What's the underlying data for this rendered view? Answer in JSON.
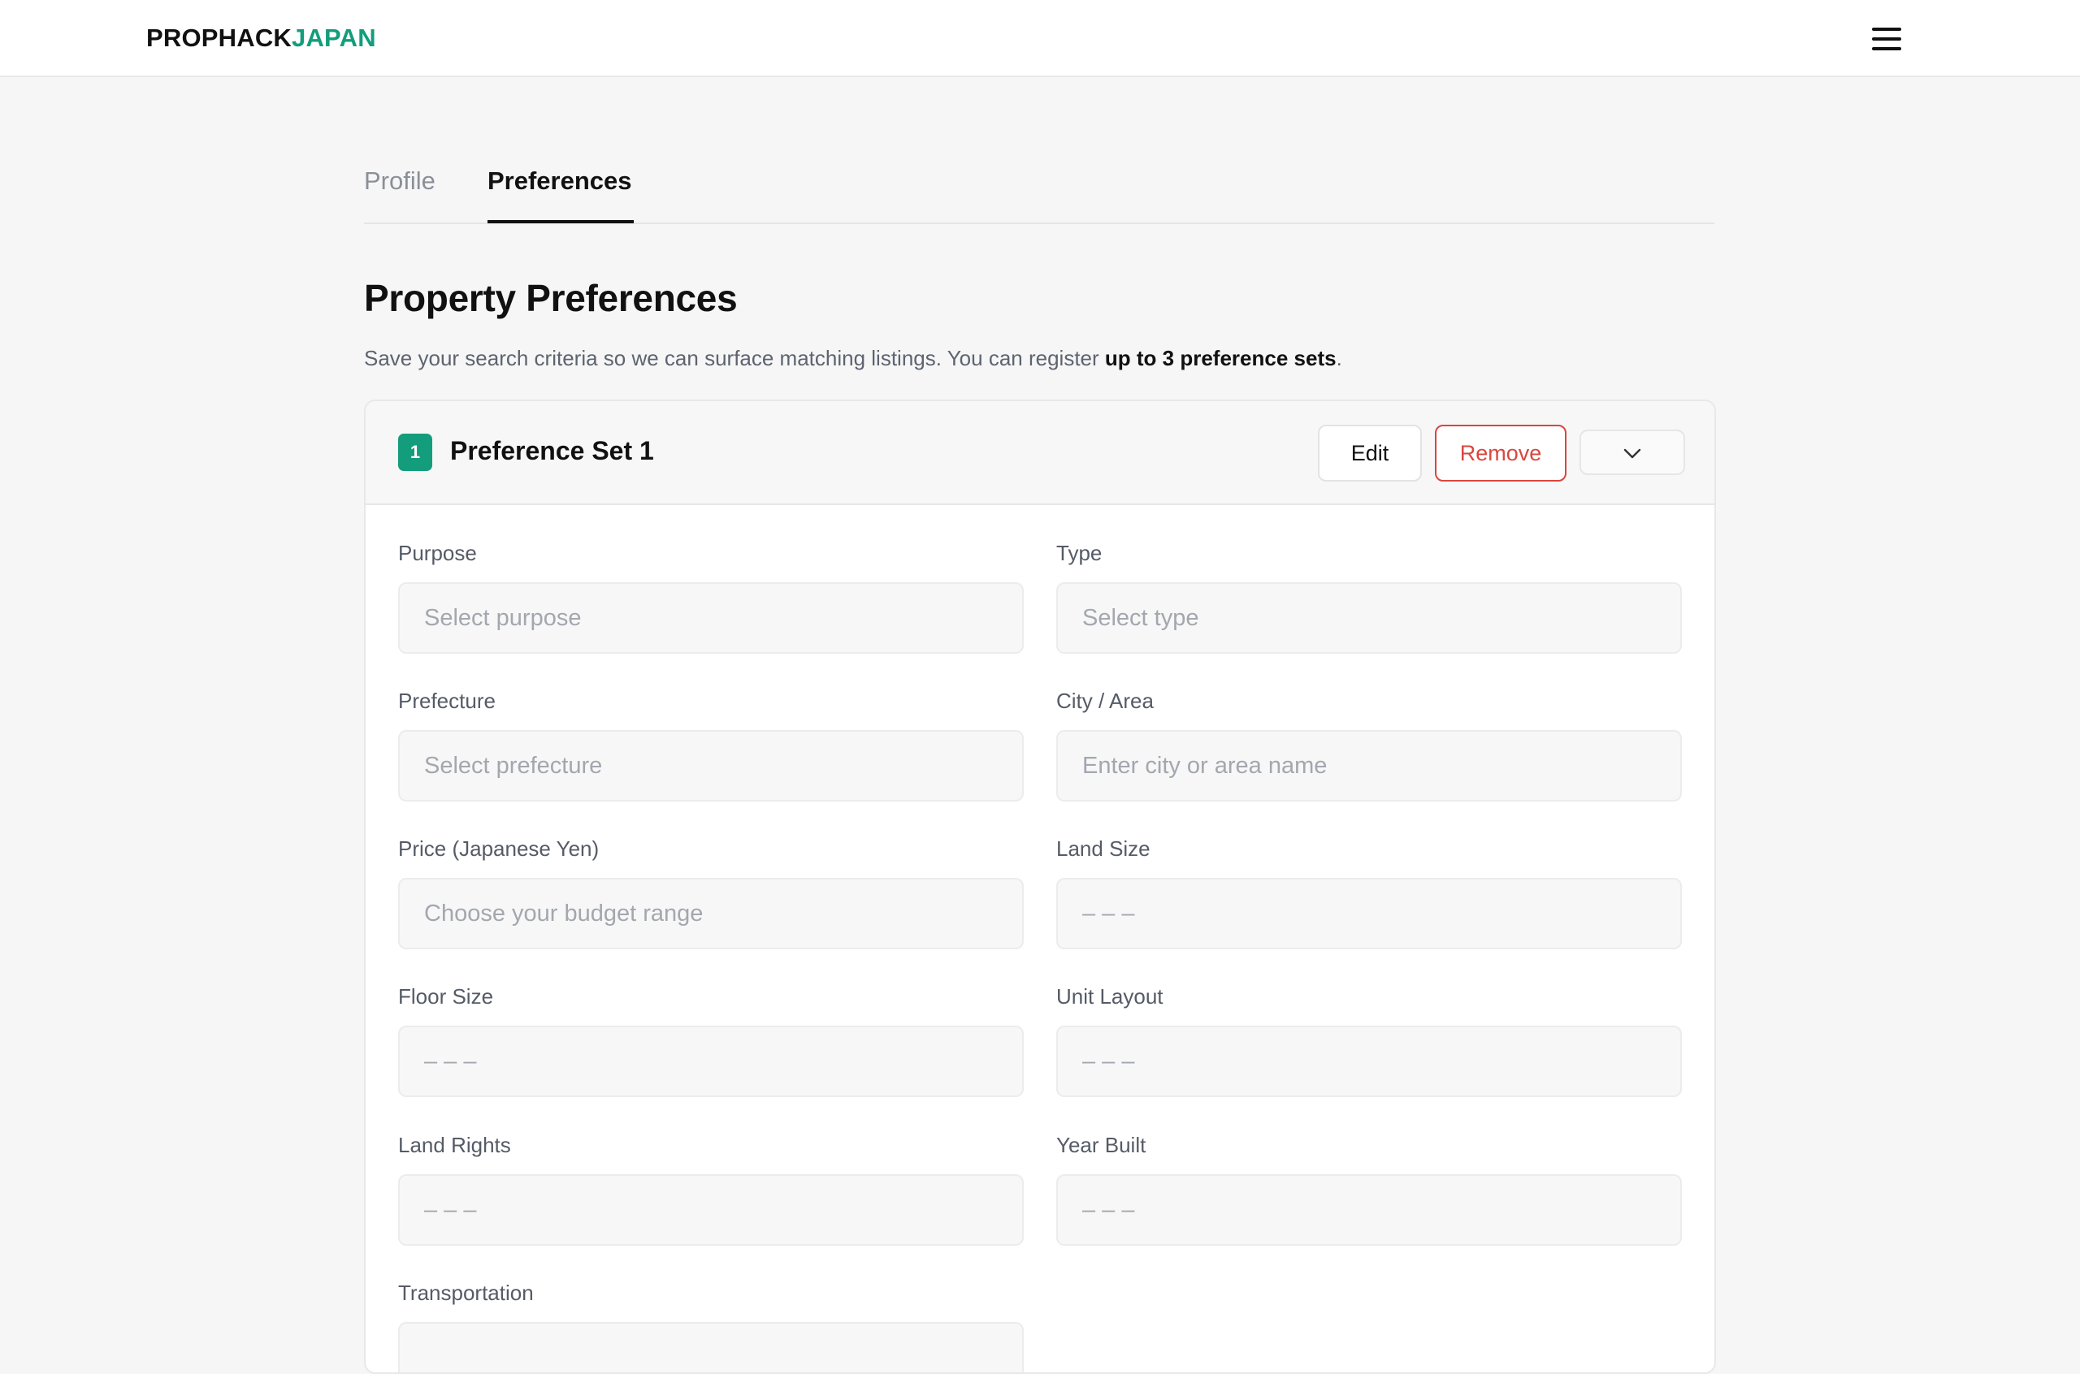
{
  "brand": {
    "part1": "PROPHACK",
    "part2": "JAPAN",
    "accent": "#139d7c"
  },
  "tabs": [
    {
      "label": "Profile",
      "active": false
    },
    {
      "label": "Preferences",
      "active": true
    }
  ],
  "page": {
    "title": "Property Preferences",
    "subtitle_pre": "Save your search criteria so we can surface matching listings. You can register ",
    "subtitle_bold": "up to 3 preference sets",
    "subtitle_post": "."
  },
  "preference_set": {
    "number": "1",
    "title": "Preference Set 1",
    "edit_label": "Edit",
    "remove_label": "Remove",
    "remove_color": "#d9463f"
  },
  "fields": {
    "purpose": {
      "label": "Purpose",
      "placeholder": "Select purpose"
    },
    "type": {
      "label": "Type",
      "placeholder": "Select type"
    },
    "prefecture": {
      "label": "Prefecture",
      "placeholder": "Select prefecture"
    },
    "city": {
      "label": "City / Area",
      "placeholder": "Enter city or area name"
    },
    "price": {
      "label": "Price (Japanese Yen)",
      "placeholder": "Choose your budget range"
    },
    "land_size": {
      "label": "Land Size",
      "placeholder": "– – –"
    },
    "floor_size": {
      "label": "Floor Size",
      "placeholder": "– – –"
    },
    "unit_layout": {
      "label": "Unit Layout",
      "placeholder": "– – –"
    },
    "land_rights": {
      "label": "Land Rights",
      "placeholder": "– – –"
    },
    "year_built": {
      "label": "Year Built",
      "placeholder": "– – –"
    },
    "transportation": {
      "label": "Transportation",
      "placeholder": ""
    }
  }
}
